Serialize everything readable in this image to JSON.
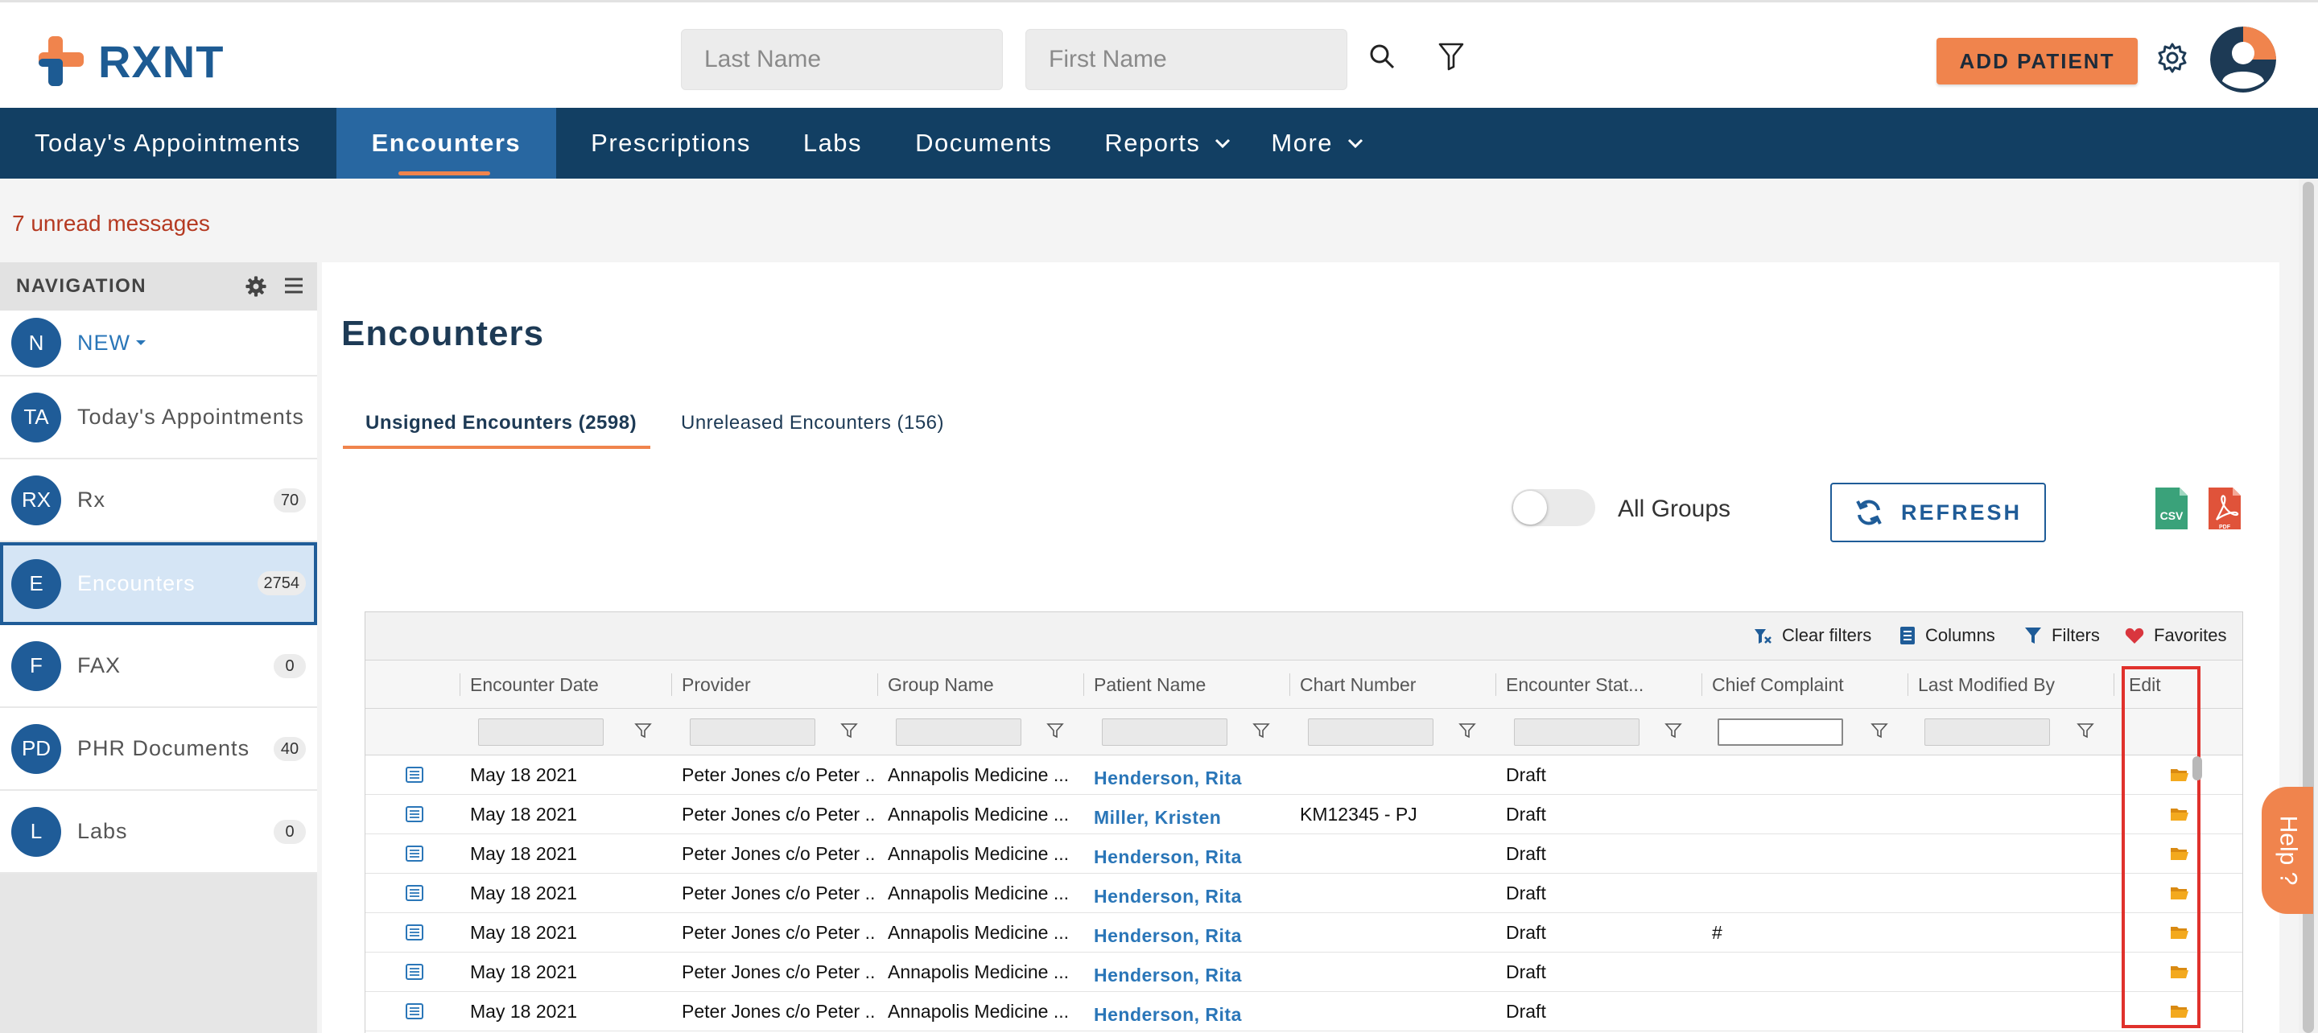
{
  "brand": {
    "name": "RXNT",
    "orange": "#f0844d",
    "navy": "#123f63",
    "blue": "#2867a1"
  },
  "header": {
    "last_name_placeholder": "Last Name",
    "first_name_placeholder": "First Name",
    "add_patient_label": "ADD PATIENT",
    "icons": [
      "search-icon",
      "filter-icon",
      "gear-icon",
      "user-avatar"
    ]
  },
  "topnav": {
    "items": [
      {
        "label": "Today's Appointments"
      },
      {
        "label": "Encounters",
        "active": true
      },
      {
        "label": "Prescriptions"
      },
      {
        "label": "Labs"
      },
      {
        "label": "Documents"
      },
      {
        "label": "Reports",
        "has_caret": true
      },
      {
        "label": "More",
        "has_caret": true
      }
    ]
  },
  "unread_messages": "7 unread messages",
  "sidebar": {
    "heading": "NAVIGATION",
    "new_item": {
      "badge": "N",
      "label": "NEW"
    },
    "items": [
      {
        "badge": "TA",
        "label": "Today's Appointments",
        "count": ""
      },
      {
        "badge": "RX",
        "label": "Rx",
        "count": "70"
      },
      {
        "badge": "E",
        "label": "Encounters",
        "count": "2754",
        "active": true
      },
      {
        "badge": "F",
        "label": "FAX",
        "count": "0"
      },
      {
        "badge": "PD",
        "label": "PHR Documents",
        "count": "40"
      },
      {
        "badge": "L",
        "label": "Labs",
        "count": "0"
      }
    ]
  },
  "main": {
    "title": "Encounters",
    "tabs": [
      {
        "label": "Unsigned Encounters (2598)",
        "active": true
      },
      {
        "label": "Unreleased Encounters (156)"
      }
    ],
    "toggle_label": "All Groups",
    "toggle_on": false,
    "refresh_label": "REFRESH",
    "export": {
      "csv_label": "CSV",
      "pdf_label": "PDF"
    }
  },
  "grid": {
    "toolbar": {
      "clear_filters": "Clear filters",
      "columns": "Columns",
      "filters": "Filters",
      "favorites": "Favorites"
    },
    "columns": [
      "Encounter Date",
      "Provider",
      "Group Name",
      "Patient Name",
      "Chart Number",
      "Encounter Stat...",
      "Chief Complaint",
      "Last Modified By",
      "Edit"
    ],
    "rows": [
      {
        "date": "May 18 2021",
        "provider": "Peter Jones c/o Peter ...",
        "group": "Annapolis Medicine ...",
        "patient": "Henderson, Rita",
        "chart": "",
        "status": "Draft",
        "complaint": "",
        "modified": ""
      },
      {
        "date": "May 18 2021",
        "provider": "Peter Jones c/o Peter ...",
        "group": "Annapolis Medicine ...",
        "patient": "Miller, Kristen",
        "chart": "KM12345 - PJ",
        "status": "Draft",
        "complaint": "",
        "modified": ""
      },
      {
        "date": "May 18 2021",
        "provider": "Peter Jones c/o Peter ...",
        "group": "Annapolis Medicine ...",
        "patient": "Henderson, Rita",
        "chart": "",
        "status": "Draft",
        "complaint": "",
        "modified": ""
      },
      {
        "date": "May 18 2021",
        "provider": "Peter Jones c/o Peter ...",
        "group": "Annapolis Medicine ...",
        "patient": "Henderson, Rita",
        "chart": "",
        "status": "Draft",
        "complaint": "",
        "modified": ""
      },
      {
        "date": "May 18 2021",
        "provider": "Peter Jones c/o Peter ...",
        "group": "Annapolis Medicine ...",
        "patient": "Henderson, Rita",
        "chart": "",
        "status": "Draft",
        "complaint": "#",
        "modified": ""
      },
      {
        "date": "May 18 2021",
        "provider": "Peter Jones c/o Peter ...",
        "group": "Annapolis Medicine ...",
        "patient": "Henderson, Rita",
        "chart": "",
        "status": "Draft",
        "complaint": "",
        "modified": ""
      },
      {
        "date": "May 18 2021",
        "provider": "Peter Jones c/o Peter ...",
        "group": "Annapolis Medicine ...",
        "patient": "Henderson, Rita",
        "chart": "",
        "status": "Draft",
        "complaint": "",
        "modified": ""
      }
    ]
  },
  "help_label": "Help ?"
}
